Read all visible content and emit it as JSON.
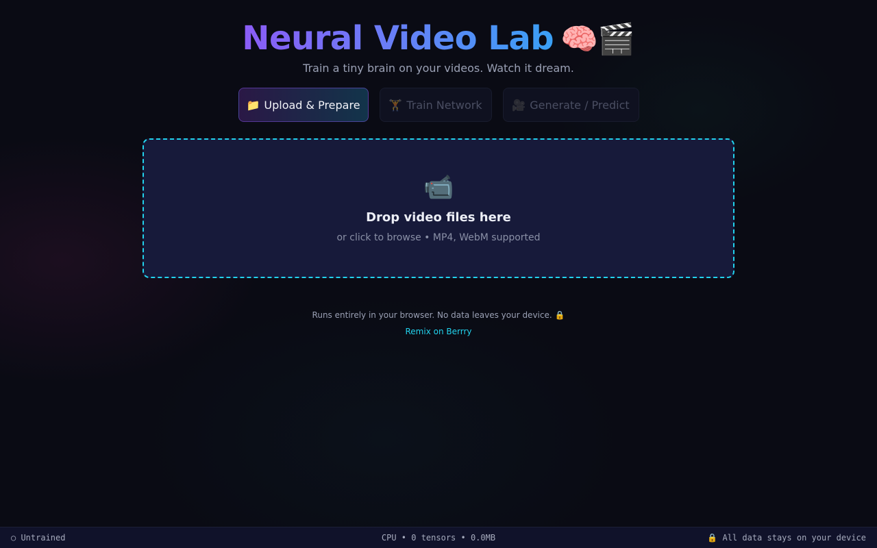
{
  "header": {
    "title": "Neural Video Lab",
    "title_emoji": "🧠🎬",
    "subtitle": "Train a tiny brain on your videos. Watch it dream."
  },
  "tabs": [
    {
      "icon": "📁",
      "label": "Upload & Prepare",
      "active": true
    },
    {
      "icon": "🏋️",
      "label": "Train Network",
      "active": false
    },
    {
      "icon": "🎥",
      "label": "Generate / Predict",
      "active": false
    }
  ],
  "dropzone": {
    "icon": "📹",
    "title": "Drop video files here",
    "subtitle": "or click to browse • MP4, WebM supported"
  },
  "footer": {
    "note": "Runs entirely in your browser. No data leaves your device. 🔒",
    "remix_label": "Remix on Berrry"
  },
  "statusbar": {
    "left": "○ Untrained",
    "center": "CPU • 0 tensors • 0.0MB",
    "right": "🔒 All data stays on your device"
  },
  "colors": {
    "accent": "#22d3ee",
    "brand_purple": "#8b5cf6",
    "brand_blue": "#3aa0f5",
    "background": "#0a0b14"
  }
}
